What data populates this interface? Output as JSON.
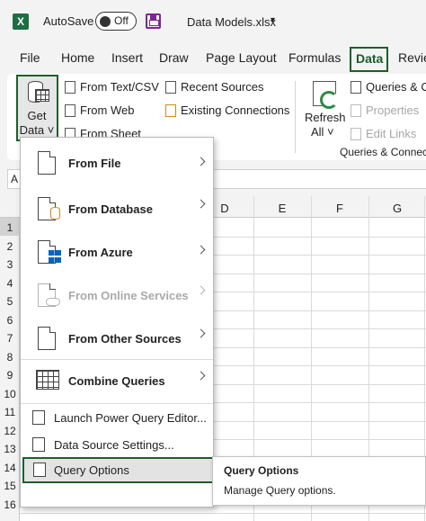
{
  "titlebar": {
    "app_logo": "X",
    "autosave_label": "AutoSave",
    "autosave_state": "Off",
    "save_icon": "save-icon",
    "filename": "Data Models.xlsx",
    "filename_caret": "▾"
  },
  "tabs": {
    "file": "File",
    "home": "Home",
    "insert": "Insert",
    "draw": "Draw",
    "page_layout": "Page Layout",
    "formulas": "Formulas",
    "data": "Data",
    "review": "Revie"
  },
  "ribbon": {
    "get_data_line1": "Get",
    "get_data_line2": "Data ˅",
    "from_text_csv": "From Text/CSV",
    "from_web": "From Web",
    "from_sheet": "From Sheet",
    "recent_sources": "Recent Sources",
    "existing_connections": "Existing Connections",
    "refresh_line1": "Refresh",
    "refresh_line2": "All ˅",
    "queries_connections": "Queries & Co",
    "properties": "Properties",
    "edit_links": "Edit Links",
    "group_queries": "Queries & Connecti"
  },
  "grid": {
    "namebox": "A",
    "columns": [
      "D",
      "E",
      "F",
      "G"
    ],
    "rows": [
      "1",
      "2",
      "3",
      "4",
      "5",
      "6",
      "7",
      "8",
      "9",
      "10",
      "11",
      "12",
      "13",
      "14",
      "15",
      "16"
    ]
  },
  "menu": {
    "from_file": "From File",
    "from_database": "From Database",
    "from_azure": "From Azure",
    "from_online_services": "From Online Services",
    "from_other_sources": "From Other Sources",
    "combine_queries": "Combine Queries",
    "launch_pq_editor": "Launch Power Query Editor...",
    "data_source_settings": "Data Source Settings...",
    "query_options": "Query Options"
  },
  "tooltip": {
    "title": "Query Options",
    "description": "Manage Query options."
  },
  "colors": {
    "accent_green": "#1e5e2c",
    "excel_green": "#1d6f42",
    "azure_blue": "#0067b8",
    "database_orange": "#d18a1a"
  }
}
